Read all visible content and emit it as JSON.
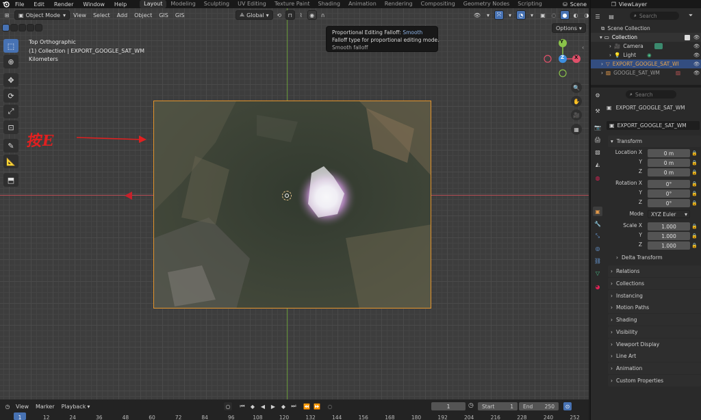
{
  "menu": {
    "items": [
      "File",
      "Edit",
      "Render",
      "Window",
      "Help"
    ],
    "workspaces": [
      "Layout",
      "Modeling",
      "Sculpting",
      "UV Editing",
      "Texture Paint",
      "Shading",
      "Animation",
      "Rendering",
      "Compositing",
      "Geometry Nodes",
      "Scripting"
    ],
    "active_workspace": "Layout",
    "scene": "Scene",
    "view_layer": "ViewLayer"
  },
  "viewport_header": {
    "mode": "Object Mode",
    "menus": [
      "View",
      "Select",
      "Add",
      "Object",
      "GIS",
      "GIS"
    ],
    "orientation": "Global",
    "options": "Options"
  },
  "overlay": {
    "view_name": "Top Orthographic",
    "collection_object": "(1) Collection | EXPORT_GOOGLE_SAT_WM",
    "units": "Kilometers",
    "annotation": "按E"
  },
  "tooltip": {
    "title": "Proportional Editing Falloff:",
    "title_value": "Smooth",
    "description": "Falloff type for proportional editing mode.",
    "detail": "Smooth falloff"
  },
  "gizmo": {
    "y": "Y",
    "x": "X",
    "z": "Z"
  },
  "outliner": {
    "search_placeholder": "Search",
    "scene_collection": "Scene Collection",
    "collection": "Collection",
    "rows": [
      "Camera",
      "Light",
      "EXPORT_GOOGLE_SAT_WM",
      "GOOGLE_SAT_WM"
    ]
  },
  "properties": {
    "search_placeholder": "Search",
    "object_name": "EXPORT_GOOGLE_SAT_WM",
    "object_datablock": "EXPORT_GOOGLE_SAT_WM",
    "transform": "Transform",
    "location_label": "Location X",
    "rotation_label": "Rotation X",
    "scale_label": "Scale X",
    "y_label": "Y",
    "z_label": "Z",
    "location": [
      "0 m",
      "0 m",
      "0 m"
    ],
    "rotation": [
      "0°",
      "0°",
      "0°"
    ],
    "mode_label": "Mode",
    "mode_value": "XYZ Euler",
    "scale": [
      "1.000",
      "1.000",
      "1.000"
    ],
    "delta_transform": "Delta Transform",
    "panels": [
      "Relations",
      "Collections",
      "Instancing",
      "Motion Paths",
      "Shading",
      "Visibility",
      "Viewport Display",
      "Line Art",
      "Animation",
      "Custom Properties"
    ]
  },
  "timeline": {
    "menus": [
      "View",
      "Marker",
      "Playback"
    ],
    "current_frame": "1",
    "start_label": "Start",
    "start": "1",
    "end_label": "End",
    "end": "250",
    "ticks": [
      "1",
      "12",
      "24",
      "36",
      "48",
      "60",
      "72",
      "84",
      "96",
      "108",
      "120",
      "132",
      "144",
      "156",
      "168",
      "180",
      "192",
      "204",
      "216",
      "228",
      "240",
      "252"
    ]
  },
  "colors": {
    "accent": "#4772b3",
    "selection_outline": "#e5952c",
    "annotation_red": "#e02020",
    "axis_x": "#e0506a",
    "axis_y": "#8bc34a",
    "axis_z": "#3d8fe0"
  }
}
